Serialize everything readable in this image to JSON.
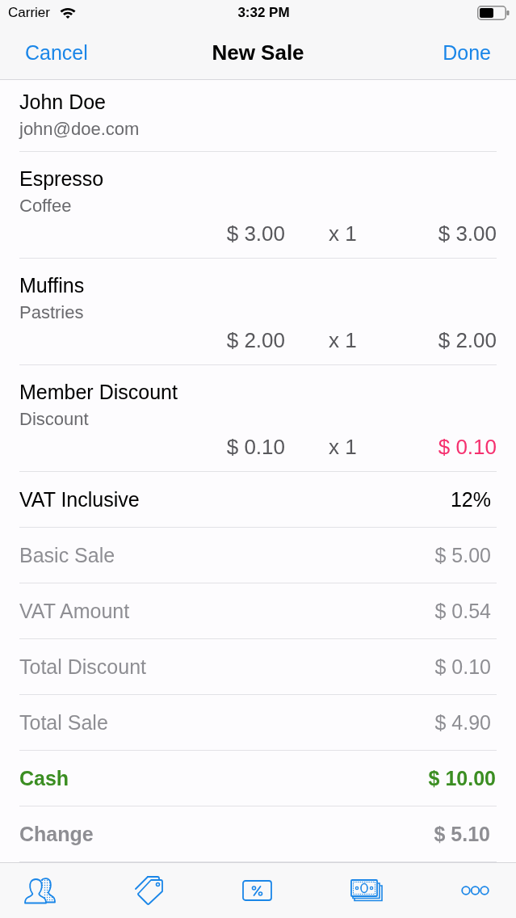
{
  "status_bar": {
    "carrier": "Carrier",
    "time": "3:32 PM"
  },
  "navigation": {
    "cancel": "Cancel",
    "title": "New Sale",
    "done": "Done"
  },
  "customer": {
    "name": "John Doe",
    "email": "john@doe.com"
  },
  "line_items": [
    {
      "kind": "product",
      "name": "Espresso",
      "category": "Coffee",
      "unit_price": "$ 3.00",
      "quantity": "x 1",
      "total": "$ 3.00"
    },
    {
      "kind": "product",
      "name": "Muffins",
      "category": "Pastries",
      "unit_price": "$ 2.00",
      "quantity": "x 1",
      "total": "$ 2.00"
    },
    {
      "kind": "discount",
      "name": "Member Discount",
      "category": "Discount",
      "unit_price": "$ 0.10",
      "quantity": "x 1",
      "total": "$ 0.10"
    }
  ],
  "summary": [
    {
      "kind": "rate",
      "label": "VAT Inclusive",
      "value": "12%"
    },
    {
      "kind": "plain",
      "label": "Basic Sale",
      "value": "$ 5.00"
    },
    {
      "kind": "plain",
      "label": "VAT Amount",
      "value": "$ 0.54"
    },
    {
      "kind": "plain",
      "label": "Total Discount",
      "value": "$ 0.10"
    },
    {
      "kind": "plain",
      "label": "Total Sale",
      "value": "$ 4.90"
    },
    {
      "kind": "payment",
      "label": "Cash",
      "value": "$ 10.00"
    },
    {
      "kind": "change",
      "label": "Change",
      "value": "$ 5.10"
    }
  ]
}
